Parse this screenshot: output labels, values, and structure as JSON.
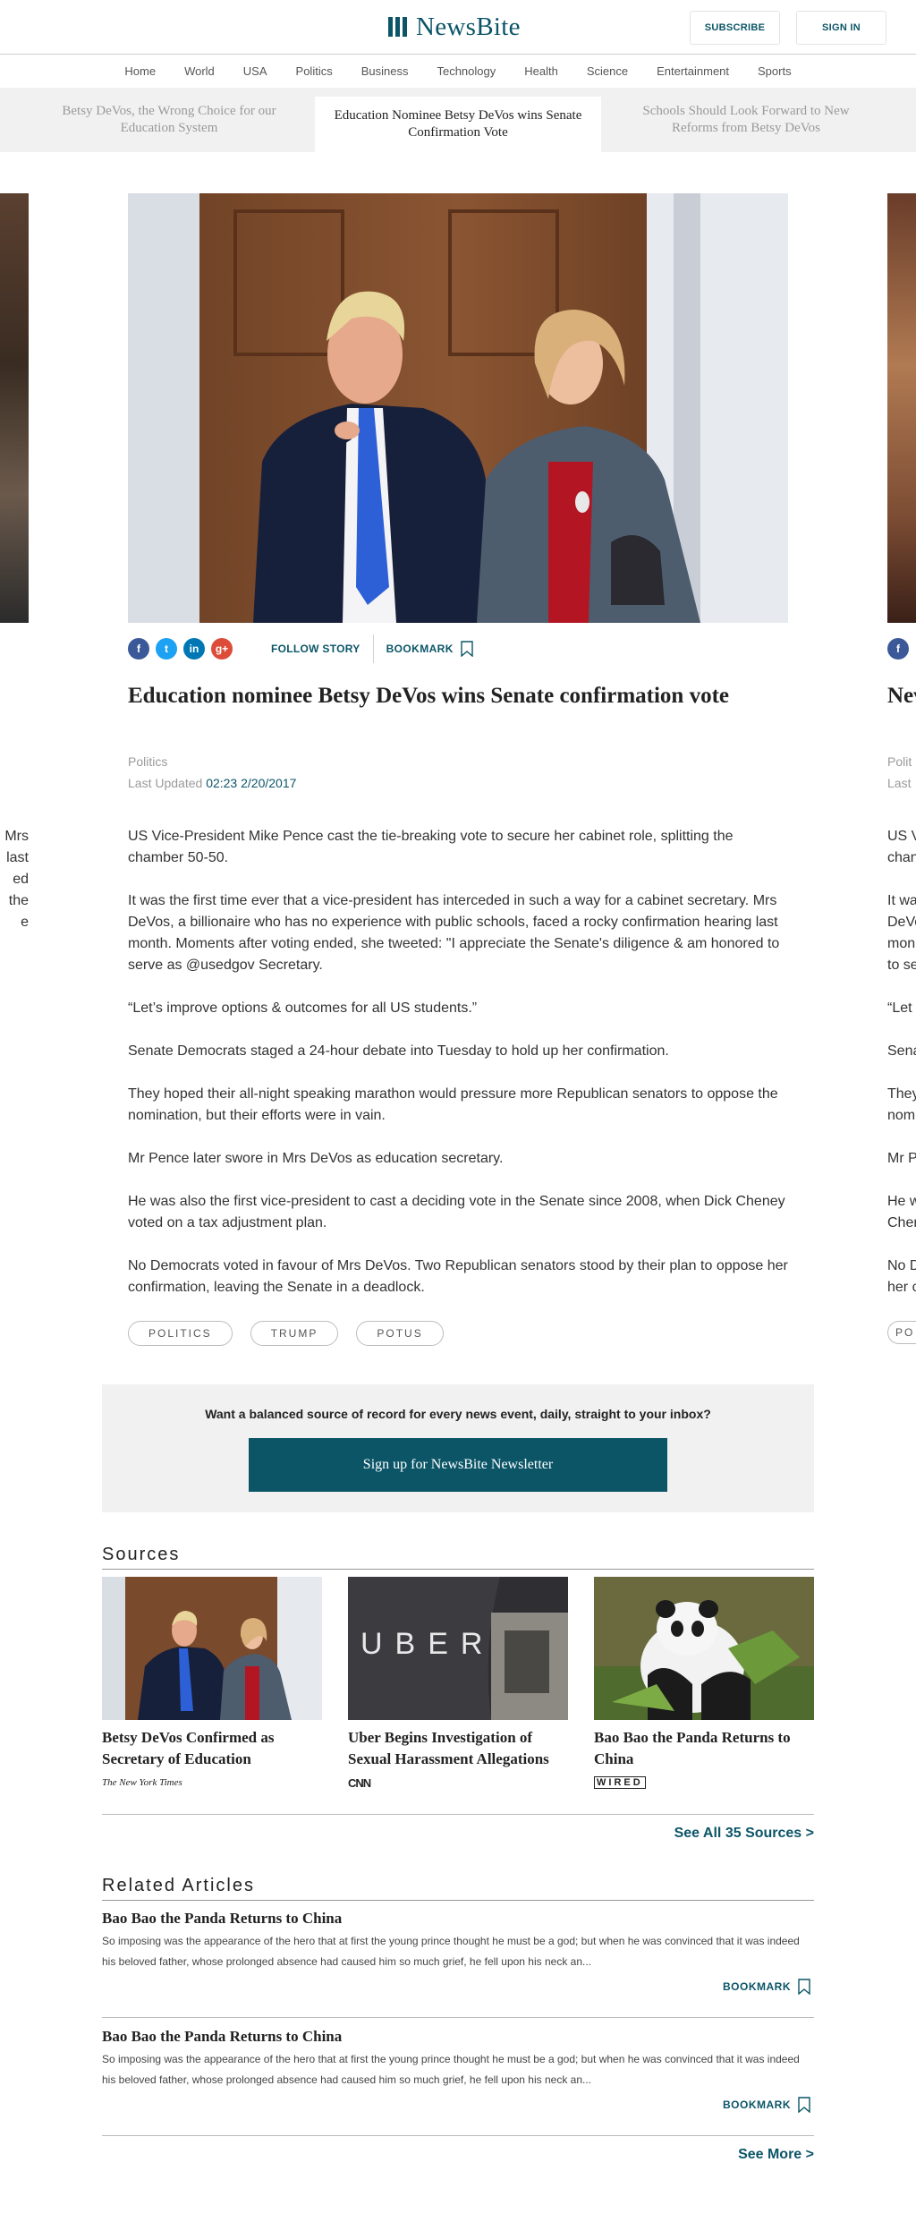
{
  "header": {
    "brand": "NewsBite",
    "subscribe_label": "SUBSCRIBE",
    "signin_label": "SIGN IN",
    "brand_color": "#0b5567"
  },
  "nav": {
    "items": [
      "Home",
      "World",
      "USA",
      "Politics",
      "Business",
      "Technology",
      "Health",
      "Science",
      "Entertainment",
      "Sports"
    ]
  },
  "story_tabs": [
    {
      "label": "Betsy DeVos, the Wrong Choice for our Education System"
    },
    {
      "label": "Education Nominee Betsy DeVos wins Senate Confirmation Vote",
      "active": true
    },
    {
      "label": "Schools Should Look Forward to New Reforms from Betsy DeVos"
    }
  ],
  "share": {
    "icons": [
      {
        "name": "facebook-icon",
        "glyph": "f",
        "color": "#3b5998"
      },
      {
        "name": "twitter-icon",
        "glyph": "t",
        "color": "#1da1f2"
      },
      {
        "name": "linkedin-icon",
        "glyph": "in",
        "color": "#0077b5"
      },
      {
        "name": "google-plus-icon",
        "glyph": "g+",
        "color": "#dd4b39"
      }
    ],
    "follow_label": "FOLLOW STORY",
    "bookmark_label": "BOOKMARK"
  },
  "article": {
    "headline": "Education nominee Betsy DeVos wins Senate confirmation vote",
    "category": "Politics",
    "updated_label": "Last Updated",
    "updated_time": "02:23 2/20/2017",
    "paragraphs": [
      "US Vice-President Mike Pence cast the tie-breaking vote to secure her cabinet role, splitting the chamber 50-50.",
      "It was the first time ever that a vice-president has interceded in such a way for a cabinet secretary. Mrs DeVos, a billionaire who has no experience with public schools, faced a rocky confirmation hearing last month. Moments after voting ended, she tweeted: \"I appreciate the Senate's diligence & am honored to serve as @usedgov Secretary.",
      "“Let’s improve options & outcomes for all US students.”",
      "Senate Democrats staged a 24-hour debate into Tuesday to hold up her confirmation.",
      "They hoped their all-night speaking marathon would pressure more Republican senators to oppose the nomination, but their efforts were in vain.",
      "Mr Pence later swore in Mrs DeVos as education secretary.",
      "He was also the first vice-president to cast a deciding vote in the Senate since 2008, when Dick Cheney voted on a tax adjustment plan.",
      "No Democrats voted in favour of Mrs DeVos. Two Republican senators stood by their plan to oppose her confirmation, leaving the Senate in a deadlock."
    ],
    "tags": [
      "POLITICS",
      "TRUMP",
      "POTUS"
    ]
  },
  "peek_right": {
    "headline_fragment": "Nev",
    "category_fragment": "Polit",
    "updated_fragment": "Last",
    "lines": [
      "US V",
      "chan",
      "",
      "It wa",
      "DeVo",
      "mon",
      "to se",
      "",
      "“Let",
      "",
      "Sena",
      "",
      "They",
      "nomi",
      "",
      "Mr P",
      "",
      "He w",
      "Chen",
      "",
      "No D",
      "her c"
    ],
    "tag_fragment": "PO"
  },
  "peek_left": {
    "lines": [
      "",
      "",
      "",
      "Mrs",
      "last",
      "ed",
      "",
      "",
      "",
      "",
      "",
      "",
      "the",
      "",
      "",
      "",
      "",
      "",
      "",
      "",
      "e",
      ""
    ]
  },
  "newsletter": {
    "prompt": "Want a balanced source of record for every news event, daily, straight to your inbox?",
    "button_label": "Sign up for NewsBite Newsletter"
  },
  "sources": {
    "title": "Sources",
    "items": [
      {
        "title": "Betsy DeVos Confirmed as Secretary of Education",
        "logo": "The New York Times"
      },
      {
        "title": "Uber Begins Investigation of Sexual Harassment Allegations",
        "logo": "CNN"
      },
      {
        "title": "Bao Bao the Panda Returns to China",
        "logo": "WIRED"
      }
    ],
    "see_all_label": "See All 35 Sources  >"
  },
  "related": {
    "title": "Related Articles",
    "items": [
      {
        "title": "Bao Bao the Panda Returns to China",
        "excerpt": "So imposing was the appearance of the hero that at first the young prince thought he must be a god; but when he was convinced that it was indeed his beloved father, whose prolonged absence had caused him so much grief, he fell upon his neck an...",
        "bookmark_label": "BOOKMARK"
      },
      {
        "title": "Bao Bao the Panda Returns to China",
        "excerpt": "So imposing was the appearance of the hero that at first the young prince thought he must be a god; but when he was convinced that it was indeed his beloved father, whose prolonged absence had caused him so much grief, he fell upon his neck an...",
        "bookmark_label": "BOOKMARK"
      }
    ],
    "see_more_label": "See More >"
  }
}
